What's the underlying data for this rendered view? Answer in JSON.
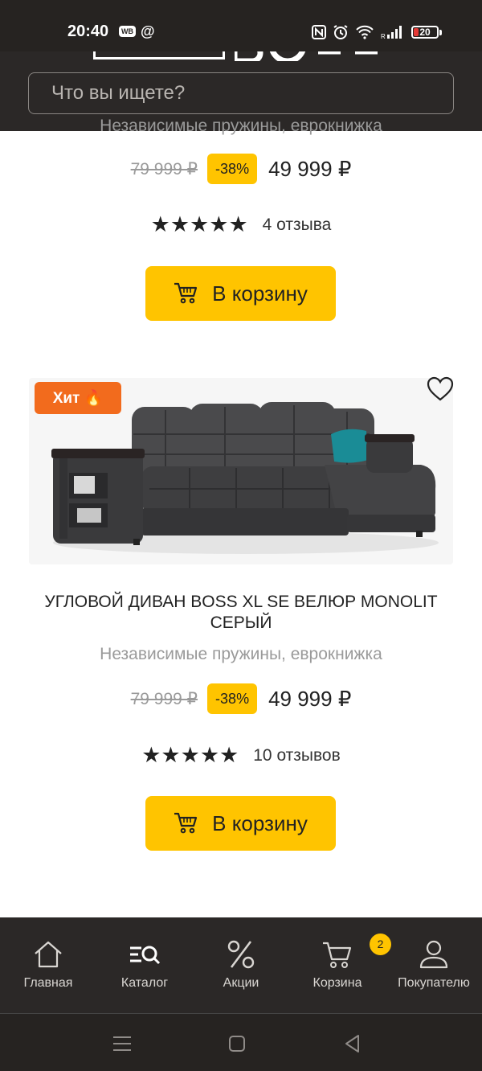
{
  "status_bar": {
    "time": "20:40",
    "left_icons": [
      "WB",
      "@"
    ],
    "battery": "20",
    "battery_level": 0.2
  },
  "header": {
    "search_placeholder": "Что вы ищете?"
  },
  "previous_product": {
    "description": "Независимые пружины, еврокнижка",
    "old_price": "79 999 ₽",
    "discount": "-38%",
    "price": "49 999 ₽",
    "stars": "★★★★★",
    "rating": 5,
    "reviews": "4 отзыва",
    "cart_label": "В корзину"
  },
  "product": {
    "badge": "Хит 🔥",
    "title": "УГЛОВОЙ ДИВАН BOSS XL SE ВЕЛЮР MONOLIT СЕРЫЙ",
    "description": "Независимые пружины, еврокнижка",
    "old_price": "79 999 ₽",
    "discount": "-38%",
    "price": "49 999 ₽",
    "stars": "★★★★★",
    "rating": 5,
    "reviews": "10 отзывов",
    "cart_label": "В корзину",
    "icon": "heart-icon"
  },
  "bottom_nav": {
    "items": [
      {
        "label": "Главная",
        "icon": "home-icon"
      },
      {
        "label": "Каталог",
        "icon": "catalog-search-icon"
      },
      {
        "label": "Акции",
        "icon": "percent-icon"
      },
      {
        "label": "Корзина",
        "icon": "cart-icon"
      },
      {
        "label": "Покупателю",
        "icon": "user-icon"
      }
    ],
    "cart_count": "2"
  },
  "colors": {
    "accent": "#ffc400",
    "dark": "#2b2827",
    "badge": "#f26b1d",
    "battery_low": "#e53935"
  }
}
